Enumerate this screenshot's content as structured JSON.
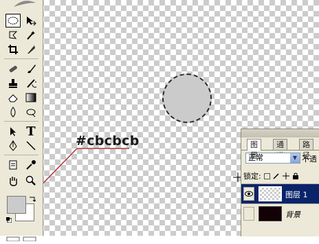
{
  "annotation": {
    "text": "#cbcbcb",
    "color": "#cbcbcb"
  },
  "tools": [
    {
      "name": "elliptical-marquee-icon",
      "selected": true
    },
    {
      "name": "move-icon"
    },
    {
      "name": "lasso-icon"
    },
    {
      "name": "magic-wand-icon"
    },
    {
      "name": "crop-icon"
    },
    {
      "name": "slice-icon"
    },
    {
      "name": "healing-brush-icon"
    },
    {
      "name": "brush-icon"
    },
    {
      "name": "clone-stamp-icon"
    },
    {
      "name": "history-brush-icon"
    },
    {
      "name": "eraser-icon"
    },
    {
      "name": "gradient-icon"
    },
    {
      "name": "blur-icon"
    },
    {
      "name": "dodge-icon"
    },
    {
      "name": "path-selection-icon"
    },
    {
      "name": "type-icon",
      "glyph": "T"
    },
    {
      "name": "pen-icon"
    },
    {
      "name": "line-icon"
    },
    {
      "name": "notes-icon"
    },
    {
      "name": "eyedropper-icon"
    },
    {
      "name": "hand-icon"
    },
    {
      "name": "zoom-icon"
    }
  ],
  "layers_panel": {
    "tabs": [
      "图层",
      "通道",
      "路径"
    ],
    "blend_mode": "正常",
    "opacity_label": "不透",
    "lock_label": "锁定:",
    "layers": [
      {
        "name": "图层 1",
        "selected": true,
        "visible": true,
        "thumb": "transparent"
      },
      {
        "name": "背景",
        "selected": false,
        "visible": false,
        "thumb": "dark",
        "italic": true
      }
    ]
  },
  "colors": {
    "foreground": "#cbcbcb",
    "background": "#ffffff",
    "leader_line": "#b03a3a"
  }
}
